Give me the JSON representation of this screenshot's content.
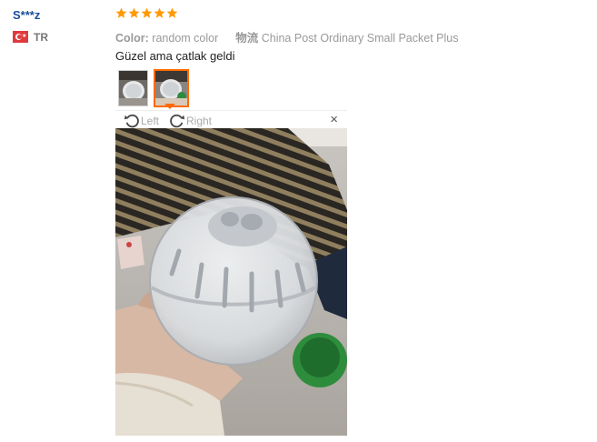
{
  "reviewer": {
    "name": "S***z",
    "country": "TR",
    "flag_colors": {
      "red": "#e03a3e",
      "white": "#ffffff"
    }
  },
  "review": {
    "rating": 5,
    "star_color": "#ff9900",
    "color_label": "Color:",
    "color_value": "random color",
    "shipping_label": "物流",
    "shipping_value": "China Post Ordinary Small Packet Plus",
    "text": "Güzel ama çatlak geldi"
  },
  "viewer": {
    "rotate_left_label": "Left",
    "rotate_right_label": "Right",
    "close_label": "×",
    "selected_thumb": 2,
    "accent": "#ff6a00"
  }
}
